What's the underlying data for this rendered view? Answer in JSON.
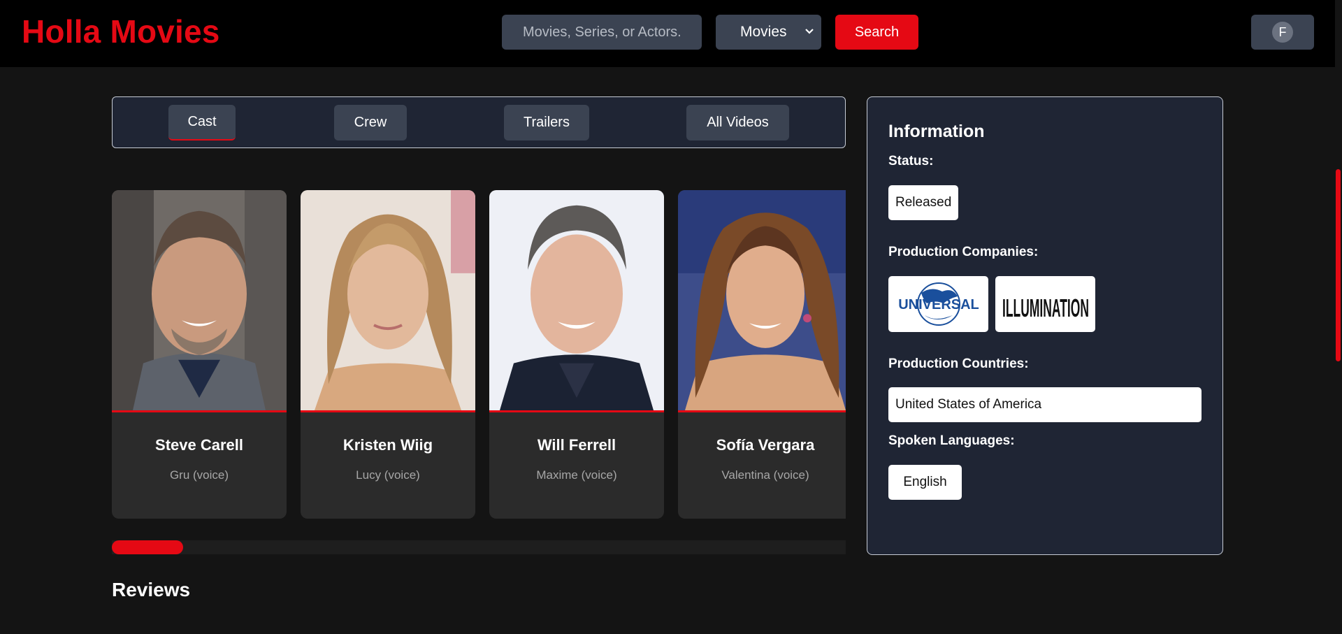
{
  "app": {
    "title": "Holla Movies"
  },
  "search": {
    "placeholder": "Movies, Series, or Actors...",
    "button_label": "Search"
  },
  "type_select": {
    "selected": "Movies"
  },
  "user": {
    "initial": "F"
  },
  "tabs": [
    {
      "label": "Cast",
      "active": true
    },
    {
      "label": "Crew",
      "active": false
    },
    {
      "label": "Trailers",
      "active": false
    },
    {
      "label": "All Videos",
      "active": false
    }
  ],
  "cast": [
    {
      "name": "Steve Carell",
      "role": "Gru (voice)"
    },
    {
      "name": "Kristen Wiig",
      "role": "Lucy (voice)"
    },
    {
      "name": "Will Ferrell",
      "role": "Maxime (voice)"
    },
    {
      "name": "Sofía Vergara",
      "role": "Valentina (voice)"
    }
  ],
  "cast_scroll": {
    "position": 0.08
  },
  "reviews": {
    "title": "Reviews"
  },
  "info": {
    "title": "Information",
    "status_label": "Status:",
    "status": "Released",
    "companies_label": "Production Companies:",
    "companies": [
      {
        "name": "UNIVERSAL"
      },
      {
        "name": "ILLUMINATION"
      }
    ],
    "countries_label": "Production Countries:",
    "countries": [
      "United States of America"
    ],
    "languages_label": "Spoken Languages:",
    "languages": [
      "English"
    ]
  },
  "colors": {
    "accent": "#e50914",
    "panel": "#1f2534",
    "control": "#3b4352",
    "background": "#141414"
  }
}
